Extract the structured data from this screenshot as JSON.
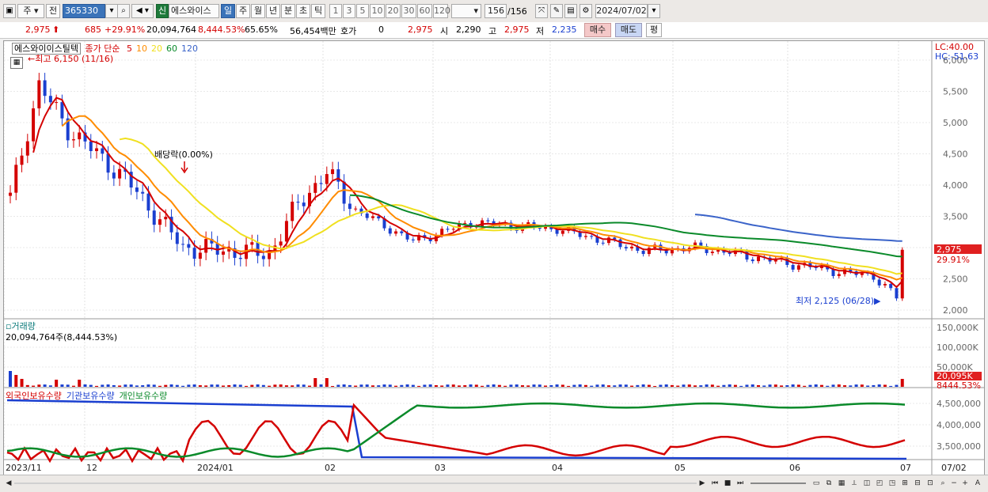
{
  "toolbar": {
    "market_label": "주",
    "type_label": "전",
    "code_value": "365330",
    "market_badge": "신",
    "stock_name": "에스와이스",
    "periods": [
      "일",
      "주",
      "월",
      "년",
      "분",
      "초",
      "틱"
    ],
    "active_period": "일",
    "intervals": [
      "1",
      "3",
      "5",
      "10",
      "20",
      "30",
      "60",
      "120"
    ],
    "count_value": "156",
    "count_total": "/156",
    "date_value": "2024/07/02"
  },
  "quote": {
    "price": "2,975",
    "change": "685",
    "change_pct": "+29.91%",
    "volume": "20,094,764",
    "volume_pct": "8,444.53%",
    "turnover_pct": "65.65%",
    "amount": "56,454백만",
    "hoga_label": "호가",
    "hoga_value": "0",
    "hoga_price": "2,975",
    "open_label": "시",
    "open_value": "2,290",
    "high_label": "고",
    "high_value": "2,975",
    "low_label": "저",
    "low_value": "2,235",
    "buy_label": "매수",
    "sell_label": "매도",
    "eval_label": "평"
  },
  "price_panel": {
    "stock_label": "에스와이이스틸텍",
    "ma_label": "종가 단순",
    "ma_periods": [
      {
        "label": "5",
        "color": "#d40000"
      },
      {
        "label": "10",
        "color": "#ff8c00"
      },
      {
        "label": "20",
        "color": "#f0e020"
      },
      {
        "label": "60",
        "color": "#0a8a2a"
      },
      {
        "label": "120",
        "color": "#3a63c9"
      }
    ],
    "high_note": "최고 6,150 (11/16)",
    "low_note": "최저 2,125 (06/28)",
    "dividend_note": "배당락(0.00%)",
    "lc_label": "LC:40.00",
    "hc_label": "HC:-51.63",
    "price_axis": [
      "6,000",
      "5,500",
      "5,000",
      "4,500",
      "4,000",
      "3,500",
      "3,000",
      "2,500",
      "2,000"
    ],
    "current_price_tag": "2,975",
    "current_pct_tag": "29.91%"
  },
  "volume_panel": {
    "title": "거래량",
    "summary": "20,094,764주(8,444.53%)",
    "axis": [
      "150,000K",
      "100,000K",
      "50,000K"
    ],
    "current_tag": "20,095K",
    "current_pct": "8444.53%"
  },
  "holding_panel": {
    "legend": [
      {
        "label": "외국인보유수량",
        "color": "#d40000"
      },
      {
        "label": "기관보유수량",
        "color": "#1a3fd0"
      },
      {
        "label": "개인보유수량",
        "color": "#0a8a2a"
      }
    ],
    "axis": [
      "4,500,000",
      "4,000,000",
      "3,500,000"
    ]
  },
  "x_axis": [
    "2023/11",
    "12",
    "2024/01",
    "02",
    "03",
    "04",
    "05",
    "06",
    "07",
    "07/02"
  ],
  "colors": {
    "up": "#d40000",
    "down": "#1a3fd0"
  }
}
